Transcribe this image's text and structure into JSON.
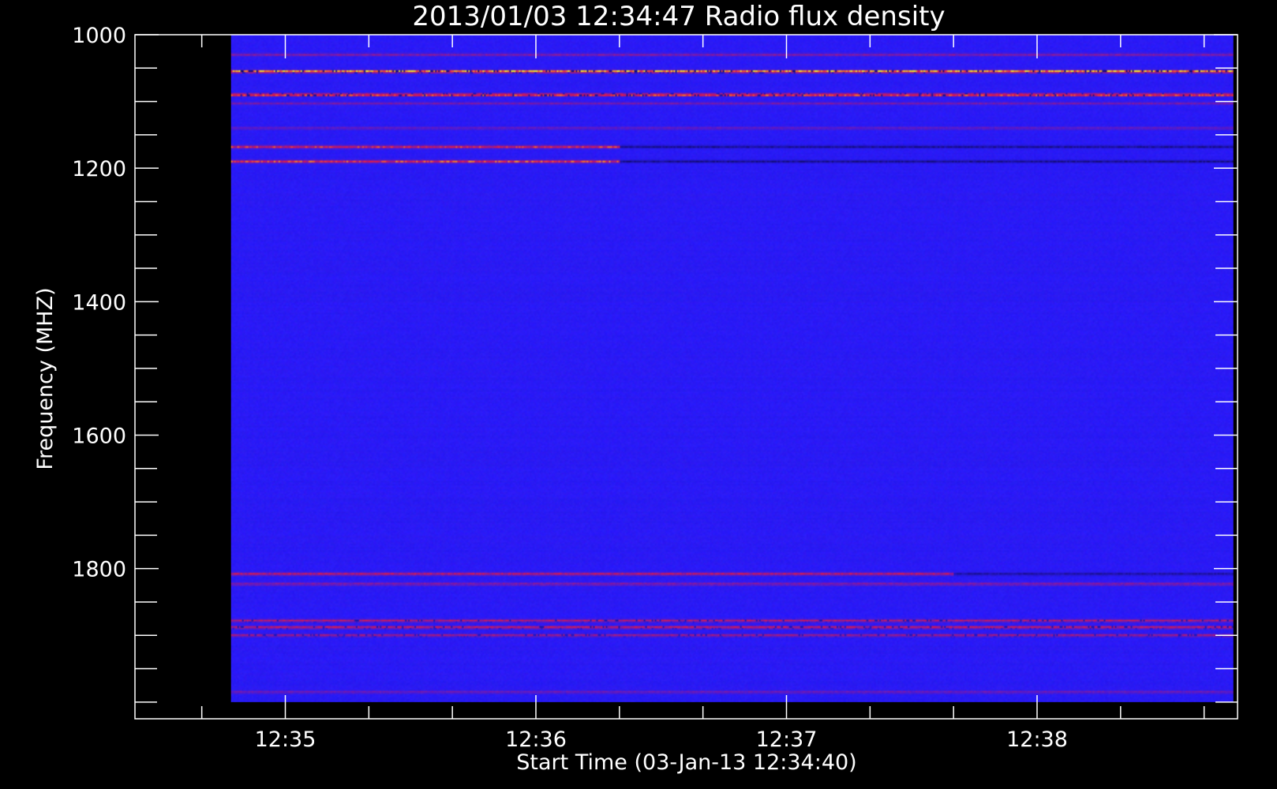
{
  "chart_data": {
    "type": "heatmap",
    "title": "2013/01/03 12:34:47 Radio flux density",
    "xlabel": "Start Time (03-Jan-13 12:34:40)",
    "ylabel": "Frequency (MHZ)",
    "x_axis": {
      "unit": "seconds since 12:34:40",
      "range": [
        -16,
        248
      ],
      "data_extent": [
        7,
        247
      ],
      "major_ticks": [
        {
          "value": 20,
          "label": "12:35"
        },
        {
          "value": 80,
          "label": "12:36"
        },
        {
          "value": 140,
          "label": "12:37"
        },
        {
          "value": 200,
          "label": "12:38"
        }
      ],
      "minor_step": 20
    },
    "y_axis": {
      "unit": "MHz",
      "inverted": true,
      "range": [
        1000,
        2025
      ],
      "data_extent": [
        1000,
        2000
      ],
      "major_ticks": [
        1000,
        1200,
        1400,
        1600,
        1800
      ],
      "minor_step": 50
    },
    "background_color": "#2a1aff",
    "colors": {
      "low": "#000000",
      "background": "#2a1aff",
      "mid": "#ff2a1a",
      "high": "#ffd81a"
    },
    "bands": [
      {
        "freq": 1030,
        "intensity": 0.35,
        "noise": 0.2
      },
      {
        "freq": 1055,
        "intensity": 1.0,
        "noise": 0.6,
        "speckle": true
      },
      {
        "freq": 1090,
        "intensity": 0.85,
        "noise": 0.55,
        "speckle": true
      },
      {
        "freq": 1103,
        "intensity": 0.3,
        "noise": 0.3
      },
      {
        "freq": 1140,
        "intensity": 0.25,
        "noise": 0.25
      },
      {
        "freq": 1168,
        "intensity": 0.7,
        "noise": 0.3,
        "fade_after": 100
      },
      {
        "freq": 1190,
        "intensity": 0.75,
        "noise": 0.3,
        "fade_after": 100
      },
      {
        "freq": 1808,
        "intensity": 0.6,
        "noise": 0.4,
        "fade_after": 180
      },
      {
        "freq": 1823,
        "intensity": 0.4,
        "noise": 0.35
      },
      {
        "freq": 1878,
        "intensity": 0.55,
        "noise": 0.5,
        "speckle": true
      },
      {
        "freq": 1888,
        "intensity": 0.6,
        "noise": 0.5,
        "speckle": true
      },
      {
        "freq": 1900,
        "intensity": 0.45,
        "noise": 0.5,
        "speckle": true
      },
      {
        "freq": 1985,
        "intensity": 0.3,
        "noise": 0.3
      }
    ],
    "grid": false,
    "legend": "none"
  }
}
